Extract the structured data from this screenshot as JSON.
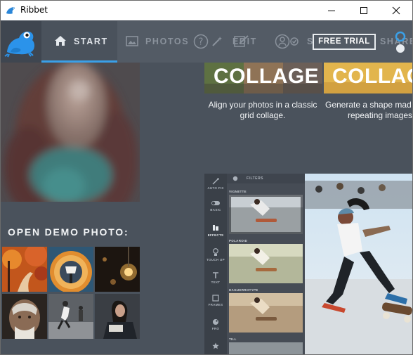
{
  "window": {
    "title": "Ribbet",
    "controls": [
      "minimize",
      "maximize",
      "close"
    ]
  },
  "nav": {
    "items": [
      {
        "label": "START",
        "icon": "home-icon",
        "active": true
      },
      {
        "label": "PHOTOS",
        "icon": "image-icon",
        "active": false
      },
      {
        "label": "EDIT",
        "icon": "edit-tools-icon",
        "active": false
      },
      {
        "label": "S",
        "icon": "people-icon",
        "active": false
      },
      {
        "label": "SHARE",
        "icon": "share-icon",
        "active": false
      }
    ],
    "free_trial": "FREE TRIAL",
    "accent": "#3aa0e8"
  },
  "hero": {
    "cards": [
      {
        "title": "COLLAGE",
        "description_line1": "Align your photos in a classic",
        "description_line2": "grid collage."
      },
      {
        "title": "COLLAG",
        "description_line1": "Generate a shape mad",
        "description_line2": "repeating images"
      }
    ]
  },
  "demo": {
    "heading": "OPEN DEMO PHOTO:",
    "photos": [
      "autumn-road",
      "tunnel",
      "light-bulb",
      "old-man",
      "skaters",
      "woman-reading"
    ]
  },
  "preview": {
    "panel_header": "FILTERS",
    "sidebar": [
      "AUTO FIX",
      "BASIC",
      "EFFECTS",
      "TOUCH UP",
      "TEXT",
      "FRAMES",
      "FRO",
      ""
    ],
    "filters": [
      "VIGNETTE",
      "POLAROID",
      "DAGUERROTYPE",
      "TILL"
    ]
  }
}
